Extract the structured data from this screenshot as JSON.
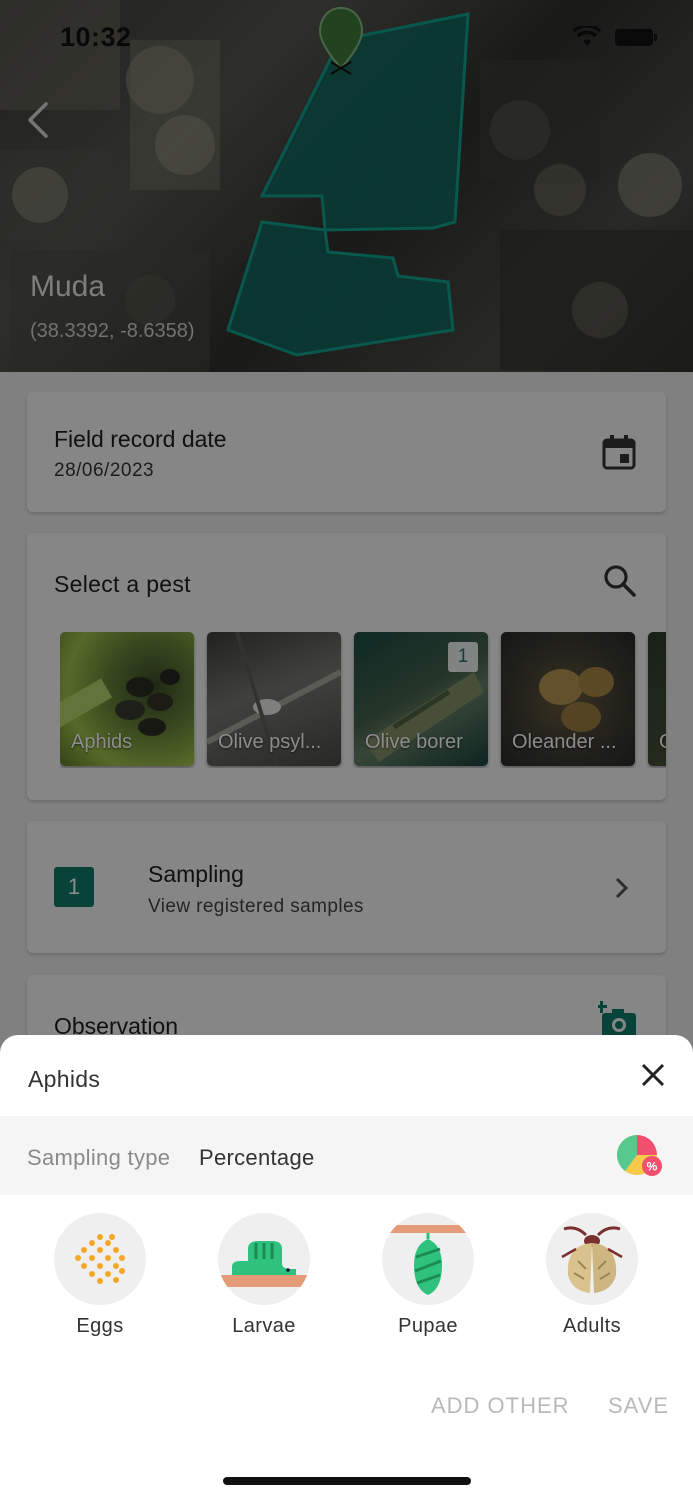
{
  "status_bar": {
    "time": "10:32"
  },
  "field": {
    "name": "Muda",
    "coordinates": "(38.3392, -8.6358)"
  },
  "record_date": {
    "label": "Field record date",
    "value": "28/06/2023"
  },
  "pest_selector": {
    "label": "Select a pest",
    "pests": [
      {
        "name": "Aphids",
        "count": ""
      },
      {
        "name": "Olive psyl...",
        "count": ""
      },
      {
        "name": "Olive borer",
        "count": "1"
      },
      {
        "name": "Oleander ...",
        "count": ""
      },
      {
        "name": "O",
        "count": ""
      }
    ]
  },
  "sampling": {
    "count": "1",
    "title": "Sampling",
    "subtitle": "View registered samples"
  },
  "observation": {
    "title": "Observation"
  },
  "sheet": {
    "title": "Aphids",
    "sampling_type_label": "Sampling type",
    "sampling_type_value": "Percentage",
    "stages": [
      {
        "label": "Eggs",
        "icon": "eggs-icon"
      },
      {
        "label": "Larvae",
        "icon": "larvae-icon"
      },
      {
        "label": "Pupae",
        "icon": "pupae-icon"
      },
      {
        "label": "Adults",
        "icon": "adults-icon"
      }
    ],
    "add_other_label": "ADD OTHER",
    "save_label": "SAVE"
  },
  "colors": {
    "accent": "#0f7b6b",
    "field_polygon": "#0e6b60"
  }
}
